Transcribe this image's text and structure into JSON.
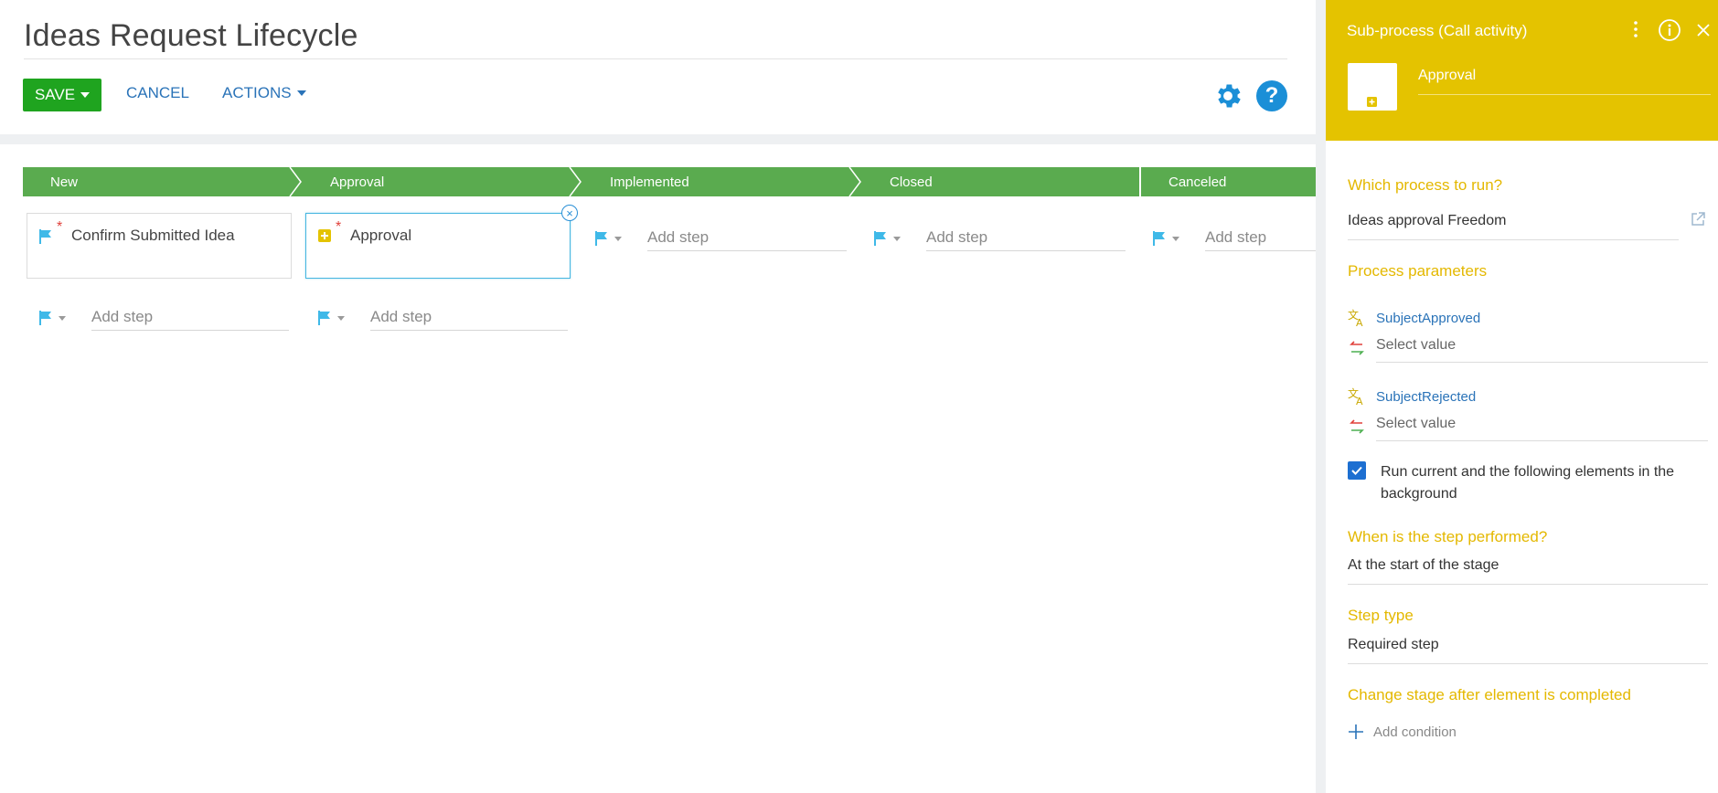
{
  "header": {
    "title": "Ideas Request Lifecycle",
    "save_label": "SAVE",
    "cancel_label": "CANCEL",
    "actions_label": "ACTIONS"
  },
  "stages": [
    "New",
    "Approval",
    "Implemented",
    "Closed",
    "Canceled"
  ],
  "steps": {
    "confirm": "Confirm Submitted Idea",
    "approval": "Approval",
    "required_mark": "*"
  },
  "add_step": {
    "placeholder": "Add step"
  },
  "panel": {
    "title": "Sub-process (Call activity)",
    "element_name": "Approval",
    "which_process_label": "Which process to run?",
    "which_process_value": "Ideas approval Freedom",
    "process_params_label": "Process parameters",
    "params": [
      {
        "name": "SubjectApproved",
        "value_placeholder": "Select value"
      },
      {
        "name": "SubjectRejected",
        "value_placeholder": "Select value"
      }
    ],
    "background_label": "Run current and the following elements in the background",
    "background_checked": true,
    "when_label": "When is the step performed?",
    "when_value": "At the start of the stage",
    "step_type_label": "Step type",
    "step_type_value": "Required step",
    "change_stage_label": "Change stage after element is completed",
    "add_condition_label": "Add condition"
  },
  "colors": {
    "stage_green": "#5aab4f",
    "save_green": "#1fa41f",
    "panel_yellow": "#e4c300",
    "link_blue": "#2a73b8",
    "flag_cyan": "#3fb9e8"
  }
}
